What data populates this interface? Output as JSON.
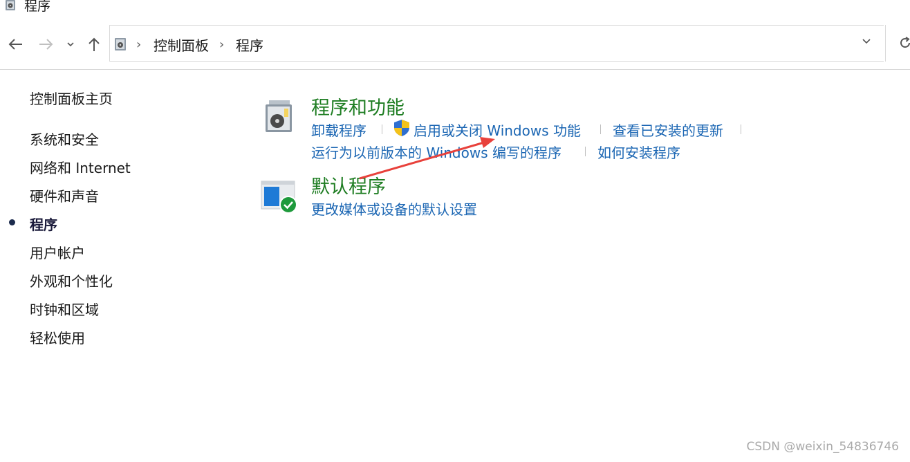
{
  "window": {
    "title": "程序"
  },
  "address_bar": {
    "crumbs": [
      "控制面板",
      "程序"
    ]
  },
  "sidebar": {
    "home": "控制面板主页",
    "items": [
      {
        "label": "系统和安全",
        "active": false
      },
      {
        "label": "网络和 Internet",
        "active": false
      },
      {
        "label": "硬件和声音",
        "active": false
      },
      {
        "label": "程序",
        "active": true
      },
      {
        "label": "用户帐户",
        "active": false
      },
      {
        "label": "外观和个性化",
        "active": false
      },
      {
        "label": "时钟和区域",
        "active": false
      },
      {
        "label": "轻松使用",
        "active": false
      }
    ]
  },
  "main": {
    "programs_features": {
      "title": "程序和功能",
      "links": [
        "卸载程序",
        "启用或关闭 Windows 功能",
        "查看已安装的更新",
        "运行为以前版本的 Windows 编写的程序",
        "如何安装程序"
      ]
    },
    "default_programs": {
      "title": "默认程序",
      "links": [
        "更改媒体或设备的默认设置"
      ]
    }
  },
  "watermark": "CSDN @weixin_54836746",
  "colors": {
    "title_green": "#1e7d22",
    "link_blue": "#1b66b3",
    "annotation_arrow": "#e8413b"
  }
}
